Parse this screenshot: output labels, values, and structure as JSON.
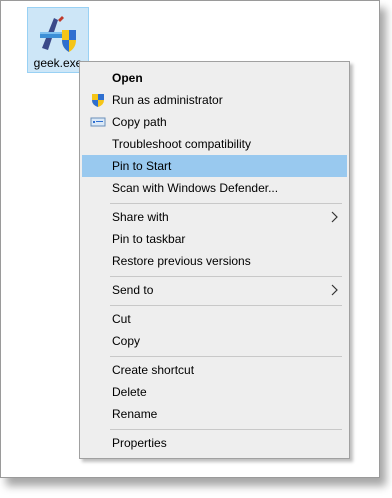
{
  "desktop": {
    "file_name": "geek.exe"
  },
  "menu": {
    "open": "Open",
    "run_as_admin": "Run as administrator",
    "copy_path": "Copy path",
    "troubleshoot": "Troubleshoot compatibility",
    "pin_to_start": "Pin to Start",
    "scan_defender": "Scan with Windows Defender...",
    "share_with": "Share with",
    "pin_to_taskbar": "Pin to taskbar",
    "restore_versions": "Restore previous versions",
    "send_to": "Send to",
    "cut": "Cut",
    "copy": "Copy",
    "create_shortcut": "Create shortcut",
    "delete": "Delete",
    "rename": "Rename",
    "properties": "Properties"
  },
  "icons": {
    "file_icon": "app-executable-icon",
    "run_admin_icon": "uac-shield-icon",
    "copy_path_icon": "path-icon",
    "submenu_arrow": "chevron-right-icon"
  },
  "colors": {
    "highlight": "#99c9ef",
    "menu_bg": "#eeeeee",
    "selection": "#cde6f7"
  }
}
